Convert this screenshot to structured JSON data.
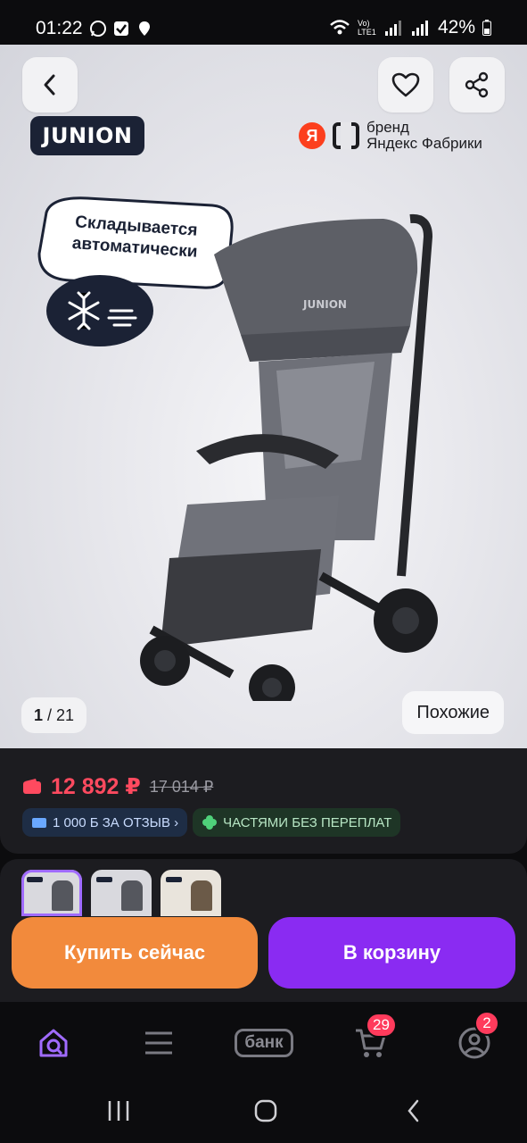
{
  "status_bar": {
    "time": "01:22",
    "network_label": "Vo) LTE1",
    "battery": "42%"
  },
  "hero": {
    "brand_logo": "JUNION",
    "yandex_brand": {
      "badge": "Я",
      "line1": "бренд",
      "line2": "Яндекс Фабрики"
    },
    "bubble_text": "Складывается автоматически",
    "pager": {
      "current": "1",
      "total": "/ 21"
    },
    "similar_label": "Похожие"
  },
  "price": {
    "current": "12 892 ₽",
    "old": "17 014 ₽",
    "chips": [
      {
        "label": "1 000 Б ЗА ОТЗЫВ ›",
        "icon": "wallet-icon"
      },
      {
        "label": "ЧАСТЯМИ БЕЗ ПЕРЕПЛАТ",
        "icon": "clover-icon"
      }
    ]
  },
  "actions": {
    "buy_now": "Купить сейчас",
    "add_to_cart": "В корзину"
  },
  "bottom_nav": {
    "bank_label": "банк",
    "cart_badge": "29",
    "profile_badge": "2"
  },
  "colors": {
    "price_red": "#ff4a5f",
    "buy_orange": "#f28a3c",
    "cart_purple": "#8a2bf2",
    "badge_red": "#ff3b5c",
    "home_accent": "#a06bff"
  }
}
